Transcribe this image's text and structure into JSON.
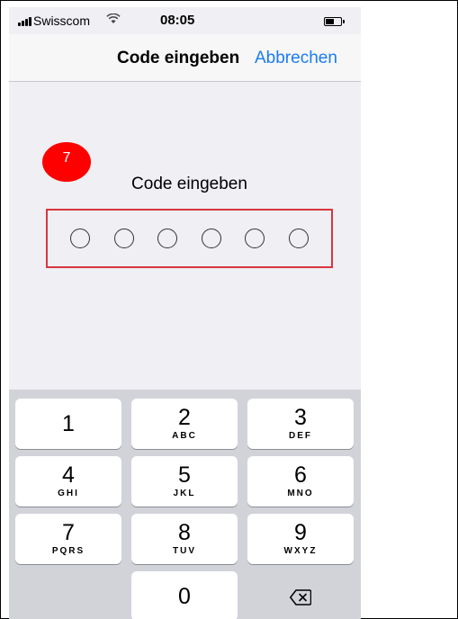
{
  "status_bar": {
    "carrier": "Swisscom",
    "time": "08:05",
    "icons": [
      "signal-icon",
      "wifi-icon",
      "battery-icon"
    ]
  },
  "nav": {
    "title": "Code eingeben",
    "cancel": "Abbrechen"
  },
  "badge": {
    "step": "7",
    "color": "#ff0000"
  },
  "prompt": "Code eingeben",
  "passcode_length": 6,
  "highlight_color": "#d9363e",
  "accent_color": "#1a7cf3",
  "keypad": {
    "keys": [
      {
        "num": "1",
        "letters": ""
      },
      {
        "num": "2",
        "letters": "ABC"
      },
      {
        "num": "3",
        "letters": "DEF"
      },
      {
        "num": "4",
        "letters": "GHI"
      },
      {
        "num": "5",
        "letters": "JKL"
      },
      {
        "num": "6",
        "letters": "MNO"
      },
      {
        "num": "7",
        "letters": "PQRS"
      },
      {
        "num": "8",
        "letters": "TUV"
      },
      {
        "num": "9",
        "letters": "WXYZ"
      },
      {
        "num": "0",
        "letters": ""
      }
    ],
    "delete_icon": "backspace-icon"
  }
}
